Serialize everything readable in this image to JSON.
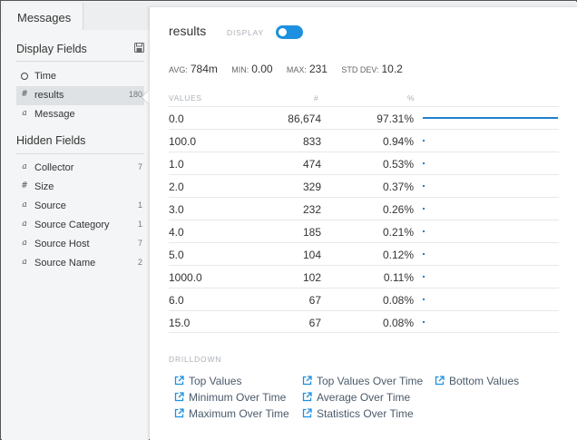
{
  "tabs": [
    {
      "label": "Messages"
    }
  ],
  "display_fields": {
    "title": "Display Fields",
    "items": [
      {
        "type_icon": "clock-icon",
        "name": "Time",
        "count": ""
      },
      {
        "type_icon": "number-icon",
        "name": "results",
        "count": "180",
        "selected": true
      },
      {
        "type_icon": "text-icon",
        "name": "Message",
        "count": ""
      }
    ]
  },
  "hidden_fields": {
    "title": "Hidden Fields",
    "items": [
      {
        "type_icon": "text-icon",
        "name": "Collector",
        "count": "7"
      },
      {
        "type_icon": "number-icon",
        "name": "Size",
        "count": ""
      },
      {
        "type_icon": "text-icon",
        "name": "Source",
        "count": "1"
      },
      {
        "type_icon": "text-icon",
        "name": "Source Category",
        "count": "1"
      },
      {
        "type_icon": "text-icon",
        "name": "Source Host",
        "count": "7"
      },
      {
        "type_icon": "text-icon",
        "name": "Source Name",
        "count": "2"
      }
    ]
  },
  "panel": {
    "title": "results",
    "display_label": "DISPLAY",
    "display_toggle": true,
    "stats": {
      "avg_label": "AVG:",
      "avg": "784m",
      "min_label": "MIN:",
      "min": "0.00",
      "max_label": "MAX:",
      "max": "231",
      "std_label": "STD DEV:",
      "std": "10.2"
    },
    "columns": {
      "values": "VALUES",
      "count": "#",
      "percent": "%"
    },
    "rows": [
      {
        "value": "0.0",
        "count": "86,674",
        "percent": "97.31%",
        "fraction": 0.9731
      },
      {
        "value": "100.0",
        "count": "833",
        "percent": "0.94%",
        "fraction": 0.0094
      },
      {
        "value": "1.0",
        "count": "474",
        "percent": "0.53%",
        "fraction": 0.0053
      },
      {
        "value": "2.0",
        "count": "329",
        "percent": "0.37%",
        "fraction": 0.0037
      },
      {
        "value": "3.0",
        "count": "232",
        "percent": "0.26%",
        "fraction": 0.0026
      },
      {
        "value": "4.0",
        "count": "185",
        "percent": "0.21%",
        "fraction": 0.0021
      },
      {
        "value": "5.0",
        "count": "104",
        "percent": "0.12%",
        "fraction": 0.0012
      },
      {
        "value": "1000.0",
        "count": "102",
        "percent": "0.11%",
        "fraction": 0.0011
      },
      {
        "value": "6.0",
        "count": "67",
        "percent": "0.08%",
        "fraction": 0.0008
      },
      {
        "value": "15.0",
        "count": "67",
        "percent": "0.08%",
        "fraction": 0.0008
      }
    ],
    "drilldown": {
      "title": "DRILLDOWN",
      "links": [
        {
          "label": "Top Values"
        },
        {
          "label": "Top Values Over Time"
        },
        {
          "label": "Bottom Values"
        },
        {
          "label": "Minimum Over Time"
        },
        {
          "label": "Average Over Time"
        },
        {
          "label": "Maximum Over Time"
        },
        {
          "label": "Statistics Over Time"
        }
      ]
    }
  },
  "colors": {
    "accent": "#1e90e0",
    "bar": "#1e7fd0"
  }
}
